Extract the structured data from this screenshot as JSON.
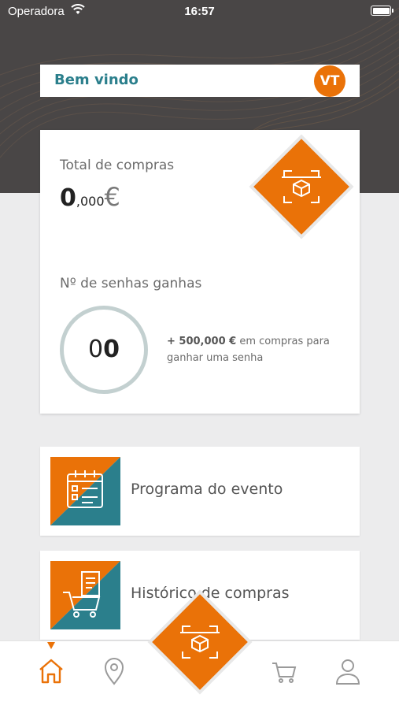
{
  "status_bar": {
    "carrier": "Operadora",
    "time": "16:57"
  },
  "header": {
    "welcome": "Bem vindo",
    "avatar_initials": "VT"
  },
  "summary": {
    "total_label": "Total de compras",
    "total_int": "0",
    "total_dec": ",000",
    "total_currency": "€",
    "senhas_label": "Nº de senhas ganhas",
    "senhas_ghost": "0",
    "senhas_value": "0",
    "note_amount": "+ 500,000 €",
    "note_text": " em compras para ganhar uma senha"
  },
  "menu": [
    {
      "label": "Programa do evento",
      "icon": "calendar-icon"
    },
    {
      "label": "Histórico de compras",
      "icon": "cart-receipt-icon"
    }
  ],
  "tabs": [
    "home-icon",
    "location-pin-icon",
    "scan-box-icon",
    "cart-icon",
    "user-icon"
  ],
  "colors": {
    "accent": "#ea7208",
    "teal": "#2b7f8c",
    "hero": "#494646"
  }
}
